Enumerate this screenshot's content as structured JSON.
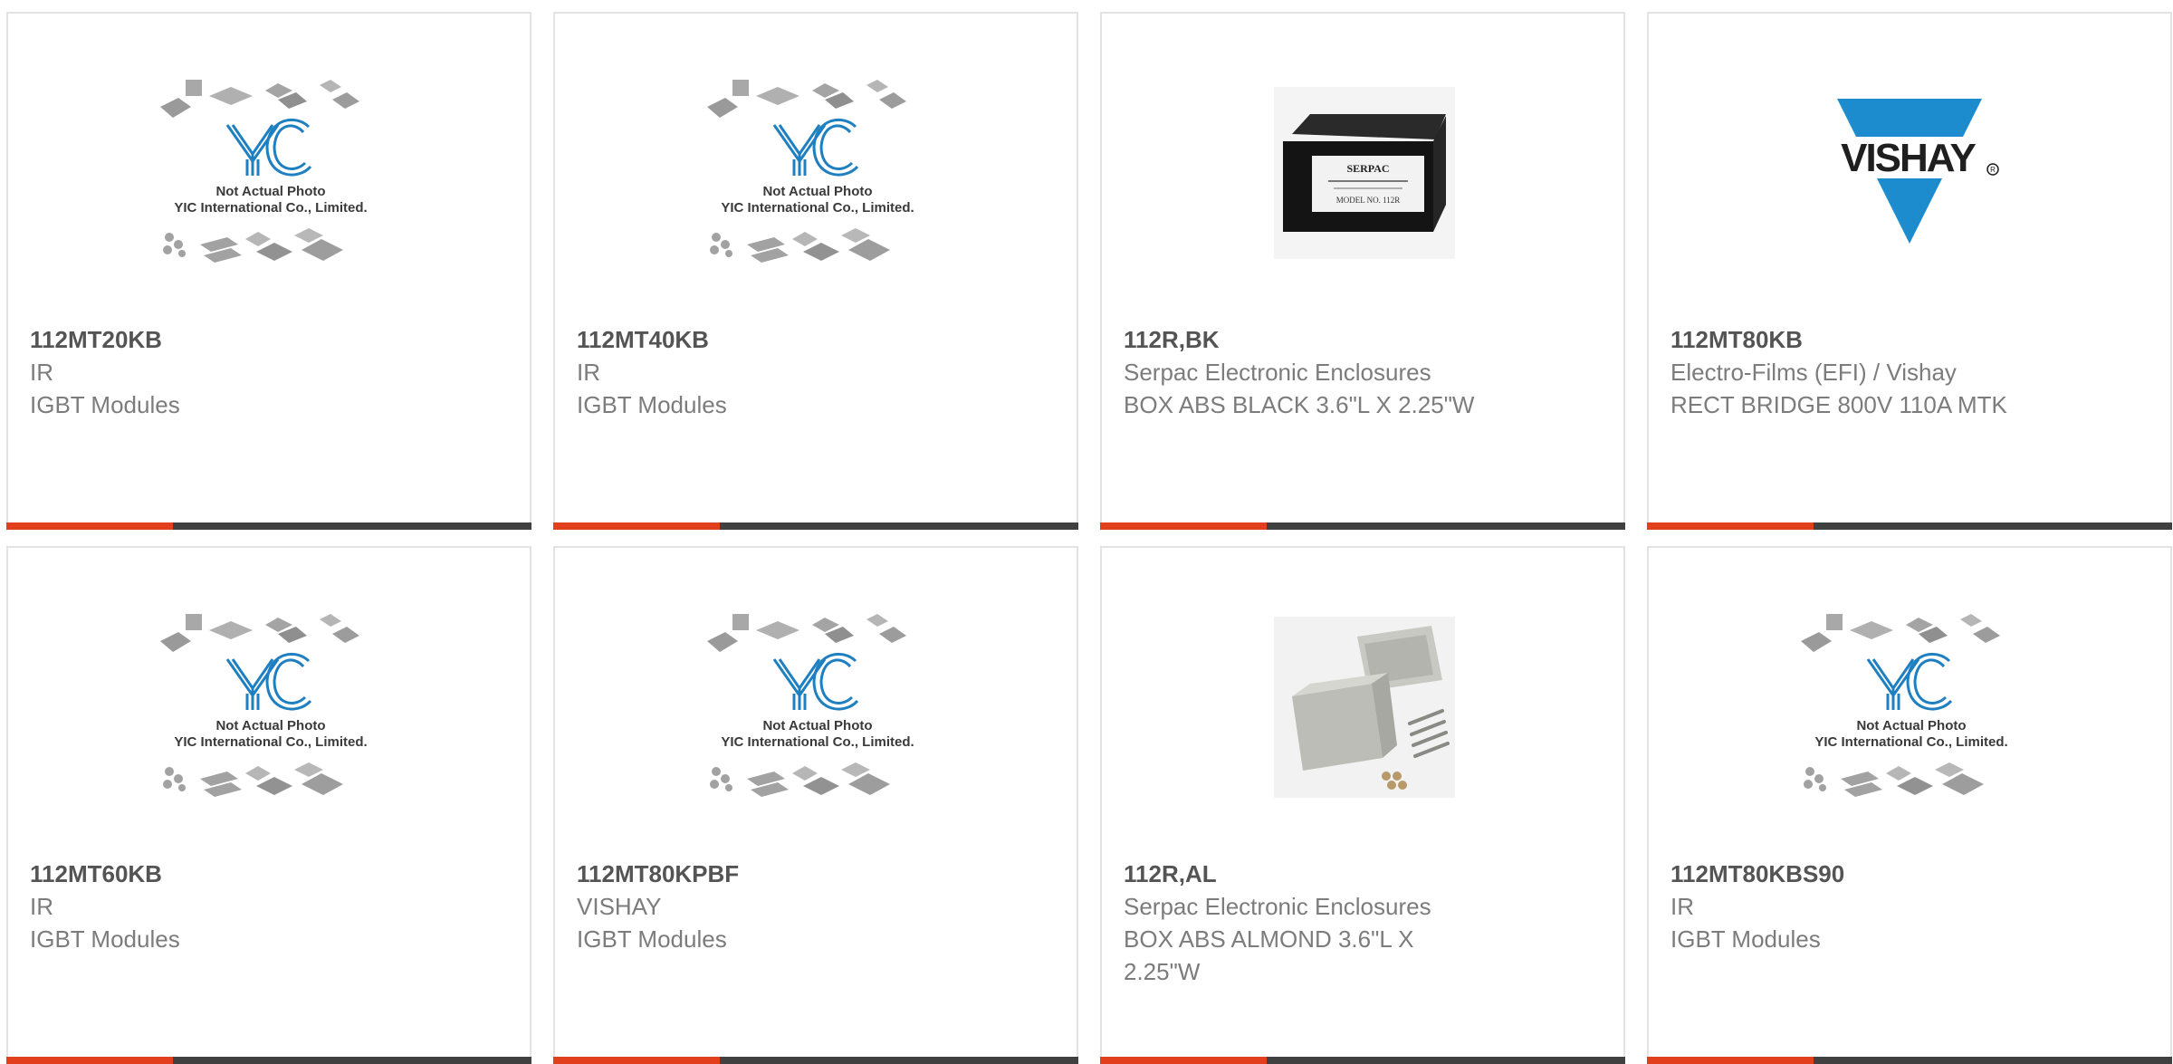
{
  "colors": {
    "accent": "#e2401c",
    "bar_dark": "#404040",
    "yic_blue": "#1e7fc1",
    "vishay_blue": "#1c8ccf"
  },
  "placeholder": {
    "line1": "Not Actual Photo",
    "line2": "YIC International Co., Limited.",
    "logo_text": "YIC"
  },
  "products": [
    {
      "part_number": "112MT20KB",
      "manufacturer": "IR",
      "description": "IGBT Modules",
      "image": "yic-placeholder"
    },
    {
      "part_number": "112MT40KB",
      "manufacturer": "IR",
      "description": "IGBT Modules",
      "image": "yic-placeholder"
    },
    {
      "part_number": "112R,BK",
      "manufacturer": "Serpac Electronic Enclosures",
      "description": "BOX ABS BLACK 3.6\"L X 2.25\"W",
      "image": "black-enclosure",
      "image_text": {
        "brand": "SERPAC",
        "model": "MODEL NO. 112R"
      }
    },
    {
      "part_number": "112MT80KB",
      "manufacturer": "Electro-Films (EFI) / Vishay",
      "description": "RECT BRIDGE 800V 110A MTK",
      "image": "vishay-logo",
      "image_text": {
        "brand": "VISHAY"
      }
    },
    {
      "part_number": "112MT60KB",
      "manufacturer": "IR",
      "description": "IGBT Modules",
      "image": "yic-placeholder"
    },
    {
      "part_number": "112MT80KPBF",
      "manufacturer": "VISHAY",
      "description": "IGBT Modules",
      "image": "yic-placeholder"
    },
    {
      "part_number": "112R,AL",
      "manufacturer": "Serpac Electronic Enclosures",
      "description": "BOX ABS ALMOND 3.6\"L X 2.25\"W",
      "image": "almond-enclosure"
    },
    {
      "part_number": "112MT80KBS90",
      "manufacturer": "IR",
      "description": "IGBT Modules",
      "image": "yic-placeholder"
    }
  ]
}
